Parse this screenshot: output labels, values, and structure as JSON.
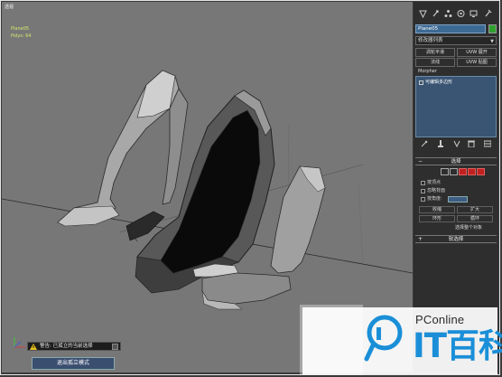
{
  "viewport": {
    "label": "透视",
    "stat_line1": "Plane05",
    "stat_line2": "Polys: 64"
  },
  "status": {
    "warning_text": "警告: 已孤立的当前选择",
    "exit_button": "退出孤立模式"
  },
  "panel": {
    "object_name": "Plane05",
    "object_color": "#2fa02f",
    "modifier_list": "修改器列表",
    "buttons": [
      "涡轮平滑",
      "UVW 展开",
      "法线",
      "UVW 贴图"
    ],
    "morpher": "Morpher",
    "stack_item": "可编辑多边形",
    "rollout_select_title": "选择",
    "options": [
      "按顶点",
      "忽略背面",
      "按角度:",
      "收缩",
      "扩大",
      "环形",
      "循环"
    ],
    "select_whole": "选择整个对象",
    "angle_value": "45.0",
    "soft_select_title": "软选择"
  },
  "watermark": {
    "brand": "PConline",
    "cn_text": "IT百科",
    "accent": "#1a8fd8"
  }
}
